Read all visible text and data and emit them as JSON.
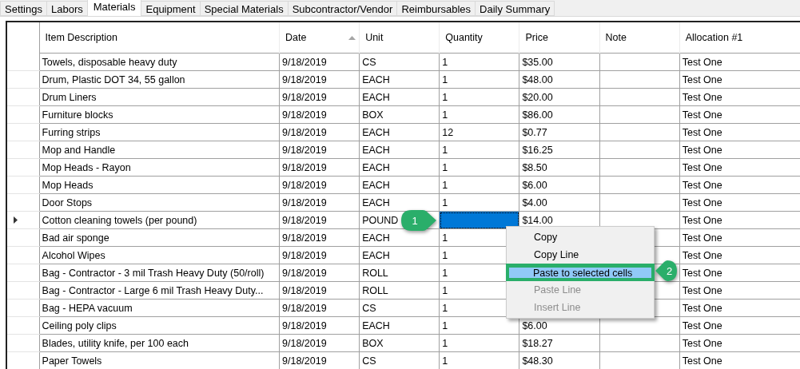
{
  "tabs": [
    {
      "label": "Settings",
      "selected": false
    },
    {
      "label": "Labors",
      "selected": false
    },
    {
      "label": "Materials",
      "selected": true
    },
    {
      "label": "Equipment",
      "selected": false
    },
    {
      "label": "Special Materials",
      "selected": false
    },
    {
      "label": "Subcontractor/Vendor",
      "selected": false
    },
    {
      "label": "Reimbursables",
      "selected": false
    },
    {
      "label": "Daily Summary",
      "selected": false
    }
  ],
  "table": {
    "columns": [
      {
        "label": "Item Description",
        "sorted": false
      },
      {
        "label": "Date",
        "sorted": true
      },
      {
        "label": "Unit",
        "sorted": false
      },
      {
        "label": "Quantity",
        "sorted": false
      },
      {
        "label": "Price",
        "sorted": false
      },
      {
        "label": "Note",
        "sorted": false
      },
      {
        "label": "Allocation #1",
        "sorted": false
      }
    ],
    "rows": [
      {
        "current": false,
        "cells": [
          "Towels, disposable heavy duty",
          "9/18/2019",
          "CS",
          "1",
          "$35.00",
          "",
          "Test One"
        ],
        "quantity_selected": false
      },
      {
        "current": false,
        "cells": [
          "Drum, Plastic DOT 34, 55 gallon",
          "9/18/2019",
          "EACH",
          "1",
          "$48.00",
          "",
          "Test One"
        ],
        "quantity_selected": false
      },
      {
        "current": false,
        "cells": [
          "Drum Liners",
          "9/18/2019",
          "EACH",
          "1",
          "$20.00",
          "",
          "Test One"
        ],
        "quantity_selected": false
      },
      {
        "current": false,
        "cells": [
          "Furniture blocks",
          "9/18/2019",
          "BOX",
          "1",
          "$86.00",
          "",
          "Test One"
        ],
        "quantity_selected": false
      },
      {
        "current": false,
        "cells": [
          "Furring strips",
          "9/18/2019",
          "EACH",
          "12",
          "$0.77",
          "",
          "Test One"
        ],
        "quantity_selected": false
      },
      {
        "current": false,
        "cells": [
          "Mop  and Handle",
          "9/18/2019",
          "EACH",
          "1",
          "$16.25",
          "",
          "Test One"
        ],
        "quantity_selected": false
      },
      {
        "current": false,
        "cells": [
          "Mop Heads - Rayon",
          "9/18/2019",
          "EACH",
          "1",
          "$8.50",
          "",
          "Test One"
        ],
        "quantity_selected": false
      },
      {
        "current": false,
        "cells": [
          "Mop Heads",
          "9/18/2019",
          "EACH",
          "1",
          "$6.00",
          "",
          "Test One"
        ],
        "quantity_selected": false
      },
      {
        "current": false,
        "cells": [
          "Door Stops",
          "9/18/2019",
          "EACH",
          "1",
          "$4.00",
          "",
          "Test One"
        ],
        "quantity_selected": false
      },
      {
        "current": true,
        "cells": [
          "Cotton cleaning towels (per pound)",
          "9/18/2019",
          "POUND",
          "",
          "$14.00",
          "",
          "Test One"
        ],
        "quantity_selected": true
      },
      {
        "current": false,
        "cells": [
          "Bad air sponge",
          "9/18/2019",
          "EACH",
          "1",
          "",
          "",
          "Test One"
        ],
        "quantity_selected": false
      },
      {
        "current": false,
        "cells": [
          "Alcohol Wipes",
          "9/18/2019",
          "EACH",
          "1",
          "",
          "",
          "Test One"
        ],
        "quantity_selected": false
      },
      {
        "current": false,
        "cells": [
          "Bag - Contractor - 3 mil Trash Heavy Duty (50/roll)",
          "9/18/2019",
          "ROLL",
          "1",
          "",
          "",
          "Test One"
        ],
        "quantity_selected": false
      },
      {
        "current": false,
        "cells": [
          "Bag - Contractor - Large 6 mil Trash Heavy Duty...",
          "9/18/2019",
          "ROLL",
          "1",
          "",
          "",
          "Test One"
        ],
        "quantity_selected": false
      },
      {
        "current": false,
        "cells": [
          "Bag - HEPA vacuum",
          "9/18/2019",
          "CS",
          "1",
          "",
          "",
          "Test One"
        ],
        "quantity_selected": false
      },
      {
        "current": false,
        "cells": [
          "Ceiling poly clips",
          "9/18/2019",
          "EACH",
          "1",
          "$6.00",
          "",
          "Test One"
        ],
        "quantity_selected": false
      },
      {
        "current": false,
        "cells": [
          "Blades, utility knife, per 100 each",
          "9/18/2019",
          "BOX",
          "1",
          "$18.27",
          "",
          "Test One"
        ],
        "quantity_selected": false
      },
      {
        "current": false,
        "cells": [
          "Paper Towels",
          "9/18/2019",
          "CS",
          "1",
          "$48.30",
          "",
          "Test One"
        ],
        "quantity_selected": false
      }
    ]
  },
  "context_menu": {
    "items": [
      {
        "label": "Copy",
        "selected": false,
        "disabled": false,
        "outlined": false
      },
      {
        "label": "Copy Line",
        "selected": false,
        "disabled": false,
        "outlined": false
      },
      {
        "label": "Paste to selected cells",
        "selected": true,
        "disabled": false,
        "outlined": true
      },
      {
        "label": "Paste Line",
        "selected": false,
        "disabled": true,
        "outlined": false
      },
      {
        "label": "Insert Line",
        "selected": false,
        "disabled": true,
        "outlined": false
      }
    ]
  },
  "callouts": [
    {
      "label": "1",
      "kind": "rightward"
    },
    {
      "label": "2",
      "kind": "leftward"
    }
  ]
}
